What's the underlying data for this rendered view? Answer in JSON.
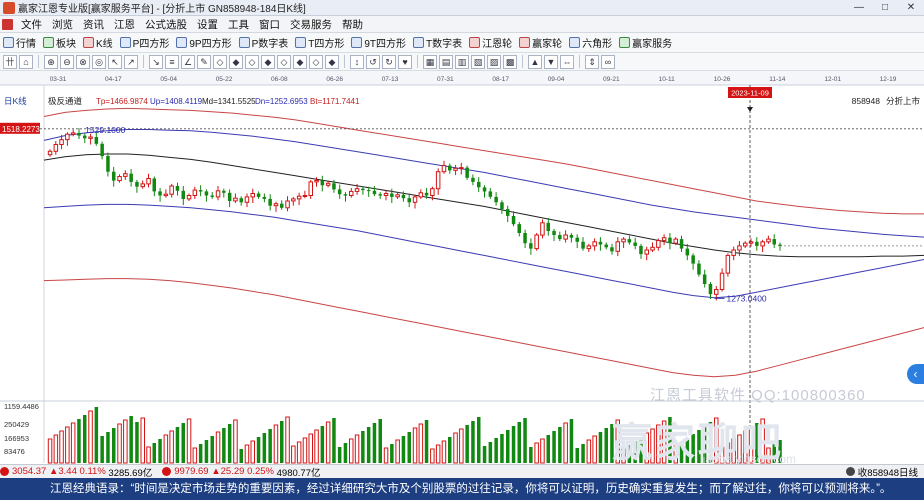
{
  "window": {
    "title": "赢家江恩专业版[赢家服务平台] - [分折上市  GN858948-184日K线]",
    "controls": [
      "—",
      "□",
      "✕"
    ]
  },
  "menu": {
    "items": [
      "文件",
      "浏览",
      "资讯",
      "江恩",
      "公式选股",
      "设置",
      "工具",
      "窗口",
      "交易服务",
      "帮助"
    ]
  },
  "toolbar": {
    "items": [
      {
        "label": "行情",
        "icon": "quote-icon",
        "tone": "blue"
      },
      {
        "label": "板块",
        "icon": "sector-icon",
        "tone": "green"
      },
      {
        "label": "K线",
        "icon": "kline-icon",
        "tone": "red"
      },
      {
        "label": "P四方形",
        "icon": "p-square-icon",
        "tone": "blue"
      },
      {
        "label": "9P四方形",
        "icon": "9p-square-icon",
        "tone": "blue"
      },
      {
        "label": "P数字表",
        "icon": "p-table-icon",
        "tone": "blue"
      },
      {
        "label": "T四方形",
        "icon": "t-square-icon",
        "tone": "blue"
      },
      {
        "label": "9T四方形",
        "icon": "9t-square-icon",
        "tone": "blue"
      },
      {
        "label": "T数字表",
        "icon": "t-table-icon",
        "tone": "blue"
      },
      {
        "label": "江恩轮",
        "icon": "gann-wheel-icon",
        "tone": "red"
      },
      {
        "label": "赢家轮",
        "icon": "winner-wheel-icon",
        "tone": "red"
      },
      {
        "label": "六角形",
        "icon": "hexagon-icon",
        "tone": "blue"
      },
      {
        "label": "赢家服务",
        "icon": "service-icon",
        "tone": "green"
      }
    ],
    "tools": [
      "卄",
      "⌂",
      "⊕",
      "⊖",
      "⊗",
      "◎",
      "↖",
      "↗",
      "↘",
      "≡",
      "∠",
      "✎",
      "◇",
      "◆",
      "◇",
      "◆",
      "◇",
      "◆",
      "◇",
      "◆",
      "↕",
      "↺",
      "↻",
      "♥",
      "▦",
      "▤",
      "▥",
      "▧",
      "▨",
      "▩",
      "▲",
      "▼",
      "⇔",
      "⇕",
      "∞"
    ]
  },
  "chart_data": {
    "type": "candlestick",
    "panel_label": "日K线",
    "code_label": "858948",
    "right_label": "分折上市",
    "indicator": {
      "name": "极反通道",
      "Tp": "Tp=1466.9874",
      "Up": "Up=1408.4119",
      "Md": "Md=1341.5525",
      "Dn": "Dn=1252.6953",
      "Bt": "Bt=1171.7441"
    },
    "date_ticks": [
      "03-31",
      "04-17",
      "05-04",
      "05-22",
      "06-08",
      "06-26",
      "07-13",
      "07-31",
      "08-17",
      "09-04",
      "09-21",
      "10-11",
      "10-26",
      "11-14",
      "12-01",
      "12-19"
    ],
    "cursor_date": "2023-11-09",
    "left_price_tag": "1518.2273",
    "annotations": [
      {
        "text": "1529.1000",
        "kind": "high"
      },
      {
        "text": "1273.0400",
        "kind": "low"
      }
    ],
    "volume_ticks": [
      "1159.4486",
      "250429",
      "166953",
      "83476"
    ],
    "ylim": [
      1140,
      1560
    ],
    "close": [
      1495,
      1505,
      1512,
      1520,
      1522,
      1518,
      1514,
      1516,
      1506,
      1488,
      1465,
      1452,
      1458,
      1462,
      1450,
      1443,
      1447,
      1455,
      1436,
      1430,
      1432,
      1444,
      1437,
      1425,
      1430,
      1438,
      1436,
      1430,
      1428,
      1437,
      1434,
      1422,
      1426,
      1420,
      1428,
      1433,
      1428,
      1425,
      1415,
      1418,
      1412,
      1422,
      1425,
      1429,
      1430,
      1450,
      1452,
      1445,
      1448,
      1439,
      1432,
      1430,
      1436,
      1440,
      1438,
      1437,
      1432,
      1430,
      1433,
      1428,
      1431,
      1426,
      1420,
      1428,
      1434,
      1430,
      1440,
      1465,
      1474,
      1467,
      1470,
      1471,
      1456,
      1450,
      1442,
      1436,
      1428,
      1420,
      1410,
      1400,
      1388,
      1375,
      1360,
      1352,
      1372,
      1390,
      1378,
      1372,
      1366,
      1372,
      1368,
      1362,
      1352,
      1356,
      1362,
      1358,
      1354,
      1348,
      1362,
      1366,
      1361,
      1356,
      1344,
      1350,
      1354,
      1364,
      1368,
      1360,
      1366,
      1352,
      1342,
      1330,
      1314,
      1300,
      1285,
      1292,
      1316,
      1342,
      1350,
      1356,
      1360,
      1362,
      1356,
      1362,
      1366,
      1358,
      1356
    ],
    "channel": {
      "top": [
        1546,
        1552,
        1555,
        1557,
        1558,
        1557,
        1556,
        1555,
        1553,
        1551,
        1548,
        1545,
        1541,
        1536,
        1531,
        1526,
        1521,
        1516,
        1511,
        1506,
        1501,
        1496,
        1491,
        1486,
        1481,
        1476,
        1470,
        1464,
        1458,
        1452,
        1446,
        1440,
        1434,
        1428,
        1422,
        1418,
        1414,
        1411,
        1408,
        1406,
        1404,
        1403,
        1403
      ],
      "upper": [
        1511,
        1518,
        1522,
        1525,
        1527,
        1527,
        1526,
        1525,
        1523,
        1520,
        1517,
        1513,
        1509,
        1504,
        1499,
        1494,
        1489,
        1484,
        1479,
        1474,
        1469,
        1464,
        1458,
        1452,
        1446,
        1440,
        1434,
        1428,
        1422,
        1416,
        1411,
        1406,
        1402,
        1398,
        1394,
        1390,
        1386,
        1382,
        1379,
        1376,
        1373,
        1371,
        1369
      ],
      "mid": [
        1482,
        1487,
        1490,
        1491,
        1491,
        1489,
        1486,
        1483,
        1479,
        1474,
        1469,
        1464,
        1459,
        1454,
        1449,
        1444,
        1439,
        1434,
        1429,
        1424,
        1419,
        1414,
        1408,
        1402,
        1396,
        1390,
        1384,
        1378,
        1372,
        1366,
        1360,
        1355,
        1350,
        1346,
        1343,
        1341,
        1340,
        1340,
        1340,
        1340,
        1341,
        1341,
        1342
      ],
      "lower": [
        1412,
        1414,
        1416,
        1417,
        1417,
        1416,
        1414,
        1412,
        1409,
        1406,
        1402,
        1398,
        1393,
        1388,
        1383,
        1378,
        1372,
        1366,
        1360,
        1354,
        1348,
        1342,
        1336,
        1330,
        1324,
        1318,
        1312,
        1306,
        1300,
        1294,
        1288,
        1283,
        1280,
        1282,
        1288,
        1294,
        1300,
        1306,
        1312,
        1318,
        1324,
        1330,
        1336
      ],
      "bottom": [
        1305,
        1306,
        1307,
        1308,
        1308,
        1307,
        1305,
        1302,
        1298,
        1294,
        1289,
        1284,
        1278,
        1272,
        1266,
        1260,
        1254,
        1248,
        1242,
        1236,
        1230,
        1224,
        1218,
        1212,
        1206,
        1200,
        1194,
        1188,
        1182,
        1176,
        1170,
        1166,
        1164,
        1166,
        1172,
        1180,
        1188,
        1196,
        1204,
        1212,
        1220,
        1228,
        1236
      ]
    }
  },
  "watermark": {
    "line1": "江恩工具软件   QQ:100800360",
    "line2": "赢家聊吧",
    "line3": "liaoba.yjgsoft.com"
  },
  "status": {
    "index1": "3054.37",
    "index1_change": "▲3.44",
    "index1_pct": "0.11%",
    "index1_amount": "3285.69亿",
    "index2": "9979.69",
    "index2_change": "▲25.29",
    "index2_pct": "0.25%",
    "index2_amount": "4980.77亿",
    "right_label": "收858948日线"
  },
  "quote": {
    "text": "江恩经典语录：“时间是决定市场走势的重要因素，经过详细研究大市及个别股票的过往记录，你将可以证明，历史确实重复发生；而了解过往，你将可以预测将来。”。"
  }
}
